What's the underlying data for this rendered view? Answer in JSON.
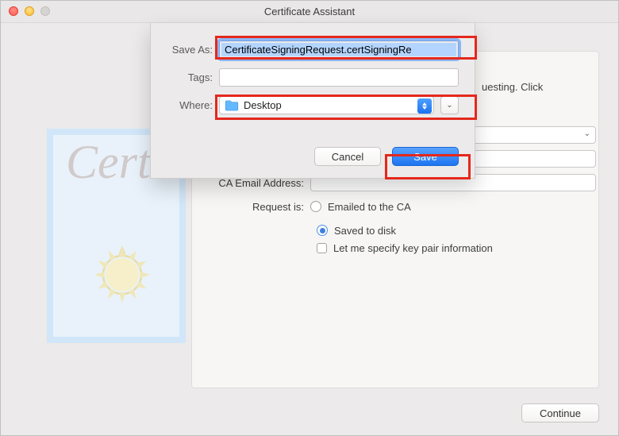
{
  "window": {
    "title": "Certificate Assistant"
  },
  "sheet": {
    "save_as_label": "Save As:",
    "save_as_value": "CertificateSigningRequest.certSigningRe",
    "tags_label": "Tags:",
    "tags_value": "",
    "where_label": "Where:",
    "where_value": "Desktop",
    "cancel_label": "Cancel",
    "save_label": "Save"
  },
  "background": {
    "hint_fragment": "uesting. Click",
    "ca_email_label": "CA Email Address:",
    "ca_email_value": "",
    "request_is_label": "Request is:",
    "option_emailed": "Emailed to the CA",
    "option_saved": "Saved to disk",
    "option_keypair": "Let me specify key pair information",
    "cert_script": "Certi"
  },
  "footer": {
    "continue_label": "Continue"
  }
}
